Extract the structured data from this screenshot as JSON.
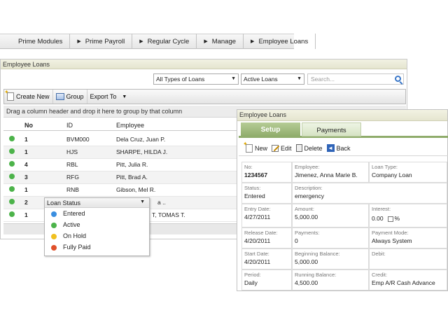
{
  "breadcrumb": [
    {
      "label": "Prime Modules",
      "arrow": false
    },
    {
      "label": "Prime Payroll",
      "arrow": true
    },
    {
      "label": "Regular Cycle",
      "arrow": true
    },
    {
      "label": "Manage",
      "arrow": true
    },
    {
      "label": "Employee Loans",
      "arrow": true
    }
  ],
  "list_panel": {
    "title": "Employee Loans",
    "type_filter": "All Types of Loans",
    "status_filter": "Active Loans",
    "search_placeholder": "Search...",
    "toolbar": {
      "create_new": "Create New",
      "group": "Group",
      "export_to": "Export To"
    },
    "drag_hint": "Drag a column header and drop it here to group by that column",
    "columns": {
      "no": "No",
      "id": "ID",
      "employee": "Employee"
    },
    "rows": [
      {
        "no": "1",
        "id": "BVM000",
        "employee": "Dela Cruz, Juan P."
      },
      {
        "no": "1",
        "id": "HJS",
        "employee": "SHARPE, HILDA J."
      },
      {
        "no": "4",
        "id": "RBL",
        "employee": "Pitt, Julia R."
      },
      {
        "no": "3",
        "id": "RFG",
        "employee": "Pitt, Brad A."
      },
      {
        "no": "1",
        "id": "RNB",
        "employee": "Gibson, Mel R."
      },
      {
        "no": "2",
        "id": "",
        "employee": "a .."
      },
      {
        "no": "1",
        "id": "",
        "employee": "T, TOMAS T."
      }
    ]
  },
  "status_popup": {
    "title": "Loan Status",
    "items": [
      {
        "label": "Entered",
        "color": "#3a8ee0"
      },
      {
        "label": "Active",
        "color": "#4cb34a"
      },
      {
        "label": "On Hold",
        "color": "#f0c020"
      },
      {
        "label": "Fully Paid",
        "color": "#e0502a"
      }
    ]
  },
  "row_status_color": "#4cb34a",
  "detail_panel": {
    "title": "Employee Loans",
    "tabs": {
      "setup": "Setup",
      "payments": "Payments"
    },
    "toolbar": {
      "new": "New",
      "edit": "Edit",
      "delete": "Delete",
      "back": "Back"
    },
    "fields": {
      "no": {
        "label": "No:",
        "value": "1234567"
      },
      "employee": {
        "label": "Employee:",
        "value": "Jimenez, Anna Marie B."
      },
      "loan_type": {
        "label": "Loan Type:",
        "value": "Company Loan"
      },
      "status": {
        "label": "Status:",
        "value": "Entered"
      },
      "description": {
        "label": "Description:",
        "value": "emergency"
      },
      "entry_date": {
        "label": "Entry Date:",
        "value": "4/27/2011"
      },
      "amount": {
        "label": "Amount:",
        "value": "5,000.00"
      },
      "interest": {
        "label": "Interest:",
        "value": "0.00",
        "unit": "%"
      },
      "release_date": {
        "label": "Release Date:",
        "value": "4/20/2011"
      },
      "payments": {
        "label": "Payments:",
        "value": "0"
      },
      "payment_mode": {
        "label": "Payment Mode:",
        "value": "Always System"
      },
      "start_date": {
        "label": "Start Date:",
        "value": "4/20/2011"
      },
      "beginning_balance": {
        "label": "Beginning Balance:",
        "value": "5,000.00"
      },
      "debit": {
        "label": "Debit:",
        "value": ""
      },
      "period": {
        "label": "Period:",
        "value": "Daily"
      },
      "running_balance": {
        "label": "Running Balance:",
        "value": "4,500.00"
      },
      "credit": {
        "label": "Credit:",
        "value": "Emp A/R Cash Advance"
      }
    }
  }
}
